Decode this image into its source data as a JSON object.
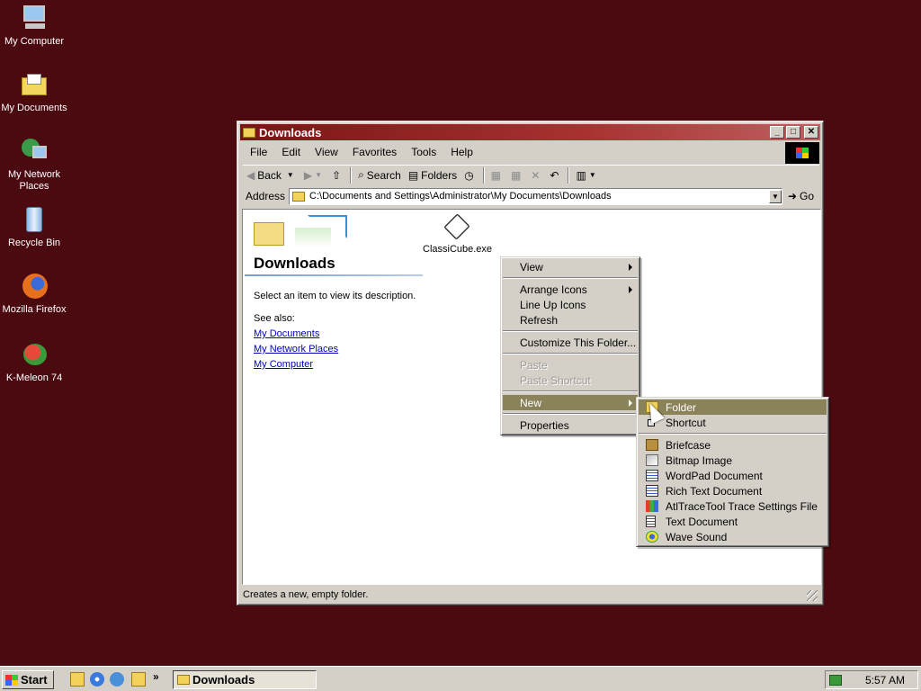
{
  "desktop": {
    "icons": [
      {
        "label": "My Computer"
      },
      {
        "label": "My Documents"
      },
      {
        "label": "My Network Places"
      },
      {
        "label": "Recycle Bin"
      },
      {
        "label": "Mozilla Firefox"
      },
      {
        "label": "K-Meleon 74"
      }
    ]
  },
  "window": {
    "title": "Downloads",
    "menu": [
      "File",
      "Edit",
      "View",
      "Favorites",
      "Tools",
      "Help"
    ],
    "toolbar": {
      "back": "Back",
      "search": "Search",
      "folders": "Folders"
    },
    "address": {
      "label": "Address",
      "value": "C:\\Documents and Settings\\Administrator\\My Documents\\Downloads",
      "go": "Go"
    },
    "panel": {
      "title": "Downloads",
      "description": "Select an item to view its description.",
      "see_also": "See also:",
      "links": [
        "My Documents",
        "My Network Places",
        "My Computer"
      ]
    },
    "file": {
      "name": "ClassiCube.exe"
    },
    "status": "Creates a new, empty folder."
  },
  "context_menu": {
    "items": [
      {
        "label": "View"
      },
      {
        "label": "Arrange Icons"
      },
      {
        "label": "Line Up Icons"
      },
      {
        "label": "Refresh"
      },
      {
        "label": "Customize This Folder..."
      },
      {
        "label": "Paste"
      },
      {
        "label": "Paste Shortcut"
      },
      {
        "label": "New"
      },
      {
        "label": "Properties"
      }
    ]
  },
  "new_menu": {
    "items": [
      {
        "label": "Folder"
      },
      {
        "label": "Shortcut"
      },
      {
        "label": "Briefcase"
      },
      {
        "label": "Bitmap Image"
      },
      {
        "label": "WordPad Document"
      },
      {
        "label": "Rich Text Document"
      },
      {
        "label": "AtlTraceTool Trace Settings File"
      },
      {
        "label": "Text Document"
      },
      {
        "label": "Wave Sound"
      }
    ]
  },
  "taskbar": {
    "start": "Start",
    "task": "Downloads",
    "clock": "5:57 AM"
  }
}
